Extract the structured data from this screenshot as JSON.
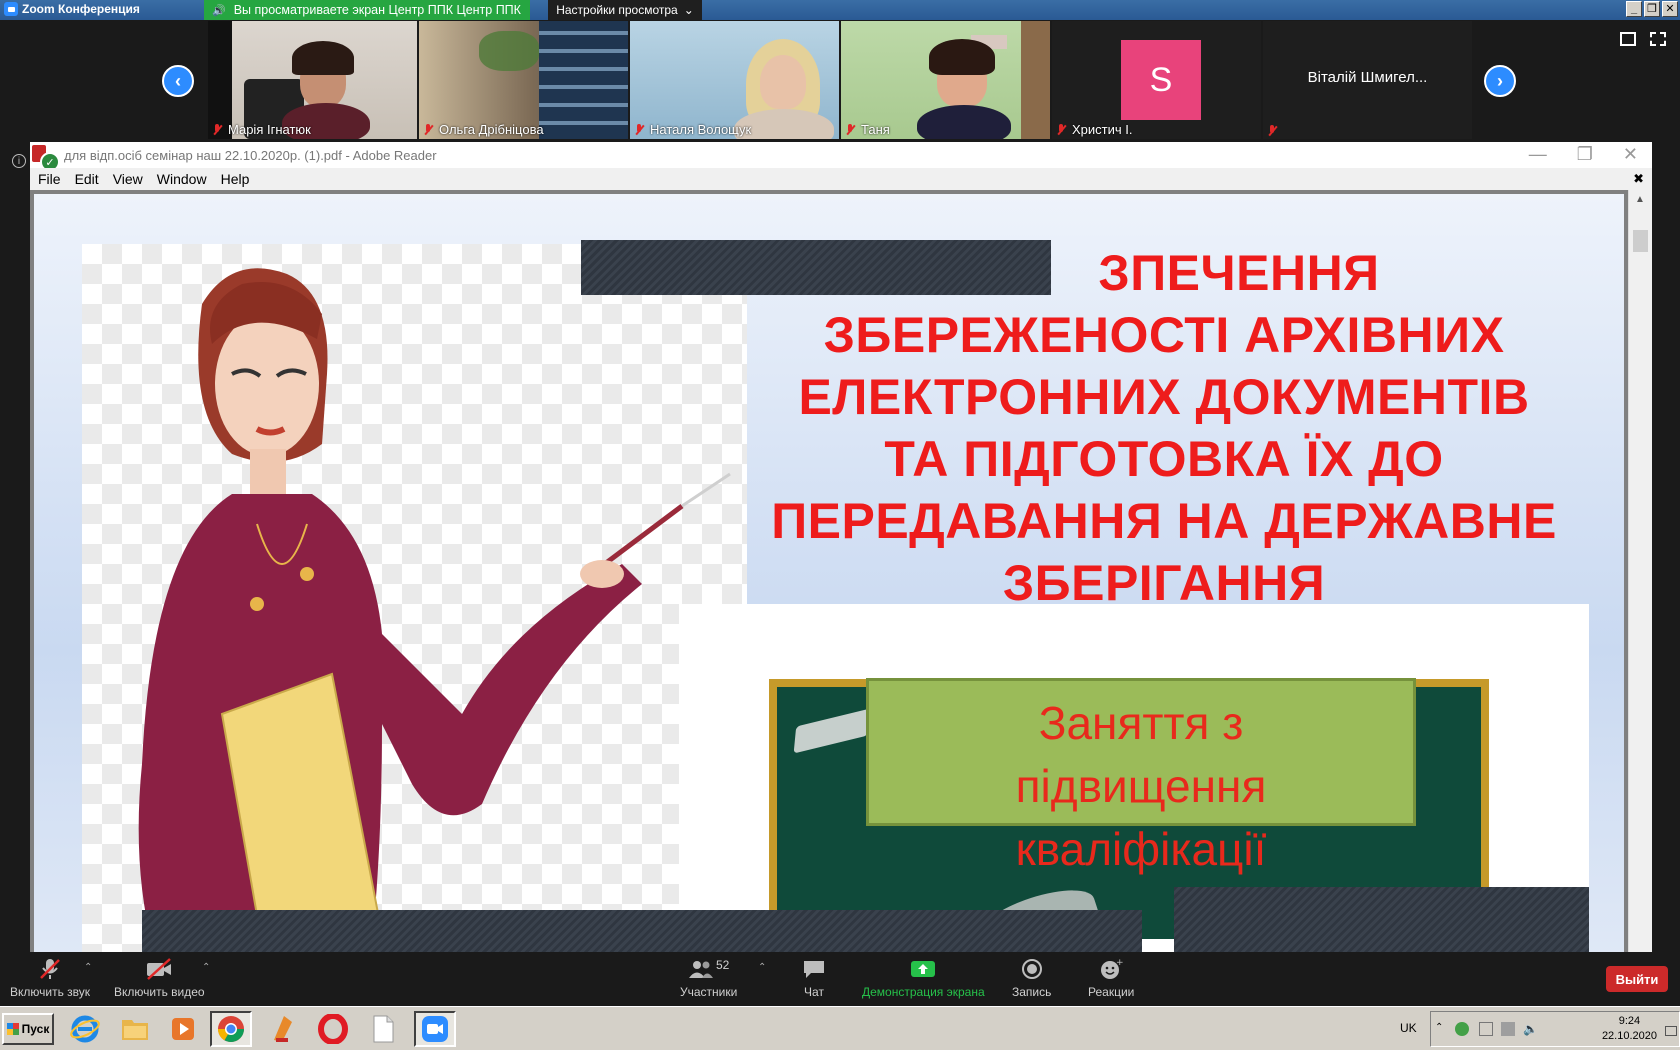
{
  "titlebar": {
    "app_title": "Zoom Конференция",
    "share_banner": "Вы просматриваете экран Центр ППК Центр ППК",
    "view_options": "Настройки просмотра",
    "controls": [
      "_",
      "❐",
      "✕"
    ]
  },
  "participants": [
    {
      "name": "Марія Ігнатюк",
      "kind": "video"
    },
    {
      "name": "Ольга Дрібніцова",
      "kind": "video"
    },
    {
      "name": "Наталя Волощук",
      "kind": "video"
    },
    {
      "name": "Таня",
      "kind": "video"
    },
    {
      "name": "Христич І.",
      "kind": "avatar",
      "initial": "S",
      "color": "#e8437b"
    },
    {
      "name": "",
      "kind": "text",
      "display_name": "Віталій Шмигел..."
    }
  ],
  "reader": {
    "title": "для відп.осіб семінар наш 22.10.2020р. (1).pdf - Adobe Reader",
    "menu": [
      "File",
      "Edit",
      "View",
      "Window",
      "Help"
    ]
  },
  "slide": {
    "heading_lines": [
      "ЗПЕЧЕННЯ",
      "ЗБЕРЕЖЕНОСТІ АРХІВНИХ",
      "ЕЛЕКТРОННИХ ДОКУМЕНТІВ",
      "ТА ПІДГОТОВКА ЇХ ДО",
      "ПЕРЕДАВАННЯ НА ДЕРЖАВНЕ",
      "ЗБЕРІГАННЯ"
    ],
    "label_lines": [
      "Заняття з",
      "підвищення",
      "кваліфікації"
    ],
    "heading_color": "#ee1c1c"
  },
  "toolbar": {
    "unmute": "Включить звук",
    "start_video": "Включить видео",
    "participants": "Участники",
    "participants_count": "52",
    "chat": "Чат",
    "share": "Демонстрация экрана",
    "record": "Запись",
    "reactions": "Реакции",
    "leave": "Выйти"
  },
  "taskbar": {
    "start": "Пуск",
    "lang": "UK",
    "time": "9:24",
    "date": "22.10.2020"
  }
}
